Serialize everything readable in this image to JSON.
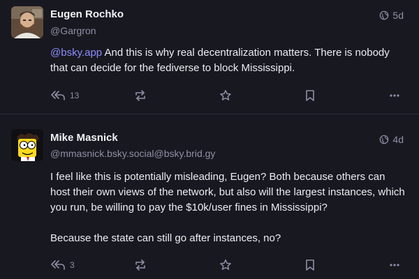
{
  "posts": [
    {
      "author_name": "Eugen Rochko",
      "author_handle": "@Gargron",
      "time": "5d",
      "mention": "@bsky.app",
      "text": " And this is why real decentralization matters. There is nobody that can decide for the fediverse to block Mississippi.",
      "reply_count": "13",
      "avatar_icon": "person-photo-avatar"
    },
    {
      "author_name": "Mike Masnick",
      "author_handle": "@mmasnick.bsky.social@bsky.brid.gy",
      "time": "4d",
      "paragraph_1": "I feel like this is potentially misleading, Eugen? Both because others can host their own views of the network, but also will the largest instances, which you run, be willing to pay the $10k/user fines in Mississippi?",
      "paragraph_2": "Because the state can still go after instances, no?",
      "reply_count": "3",
      "avatar_icon": "cartoon-character-avatar"
    }
  ],
  "icons": [
    "globe-icon",
    "reply-all-icon",
    "boost-icon",
    "star-icon",
    "bookmark-icon",
    "more-icon"
  ],
  "colors": {
    "background": "#181820",
    "divider": "#2c2c38",
    "muted": "#8e8fa6",
    "mention": "#8c8dff",
    "text": "#ececf2"
  }
}
